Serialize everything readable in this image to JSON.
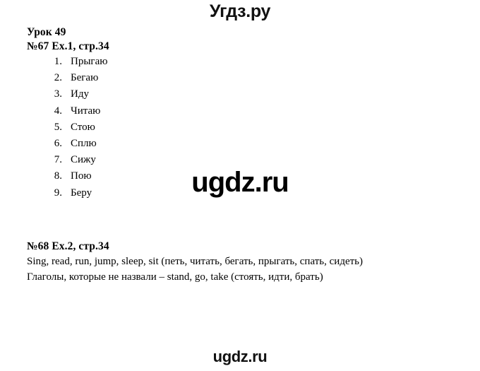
{
  "site": {
    "logo_top": "Угдз.ру",
    "watermark_center": "ugdz.ru",
    "watermark_bottom": "ugdz.ru"
  },
  "document": {
    "lesson_heading": "Урок 49",
    "exercise1": {
      "heading": "№67 Ex.1, стр.34",
      "items": [
        {
          "num": "1.",
          "word": "Прыгаю"
        },
        {
          "num": "2.",
          "word": "Бегаю"
        },
        {
          "num": "3.",
          "word": "Иду"
        },
        {
          "num": "4.",
          "word": "Читаю"
        },
        {
          "num": "5.",
          "word": "Стою"
        },
        {
          "num": "6.",
          "word": "Сплю"
        },
        {
          "num": "7.",
          "word": "Сижу"
        },
        {
          "num": "8.",
          "word": "Пою"
        },
        {
          "num": "9.",
          "word": "Беру"
        }
      ]
    },
    "exercise2": {
      "heading": "№68 Ex.2, стр.34",
      "paragraph1": "Sing, read, run, jump, sleep, sit (петь, читать, бегать, прыгать, спать, сидеть)",
      "paragraph2": "Глаголы, которые не назвали – stand, go, take (стоять, идти, брать)"
    }
  }
}
